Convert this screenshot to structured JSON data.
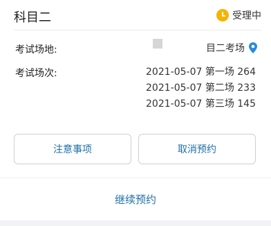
{
  "header": {
    "subject": "科目二",
    "status": "受理中",
    "status_color": "#f6b400"
  },
  "venue": {
    "label": "考试场地:",
    "value": "目二考场",
    "icon": "location-pin-icon",
    "icon_color": "#2a8bd8"
  },
  "sessions": {
    "label": "考试场次:",
    "items": [
      "2021-05-07 第一场 264",
      "2021-05-07 第二场 233",
      "2021-05-07 第三场 145"
    ]
  },
  "actions": {
    "notice_label": "注意事项",
    "cancel_label": "取消预约",
    "continue_label": "继续预约",
    "accent_color": "#1f6fa8"
  }
}
